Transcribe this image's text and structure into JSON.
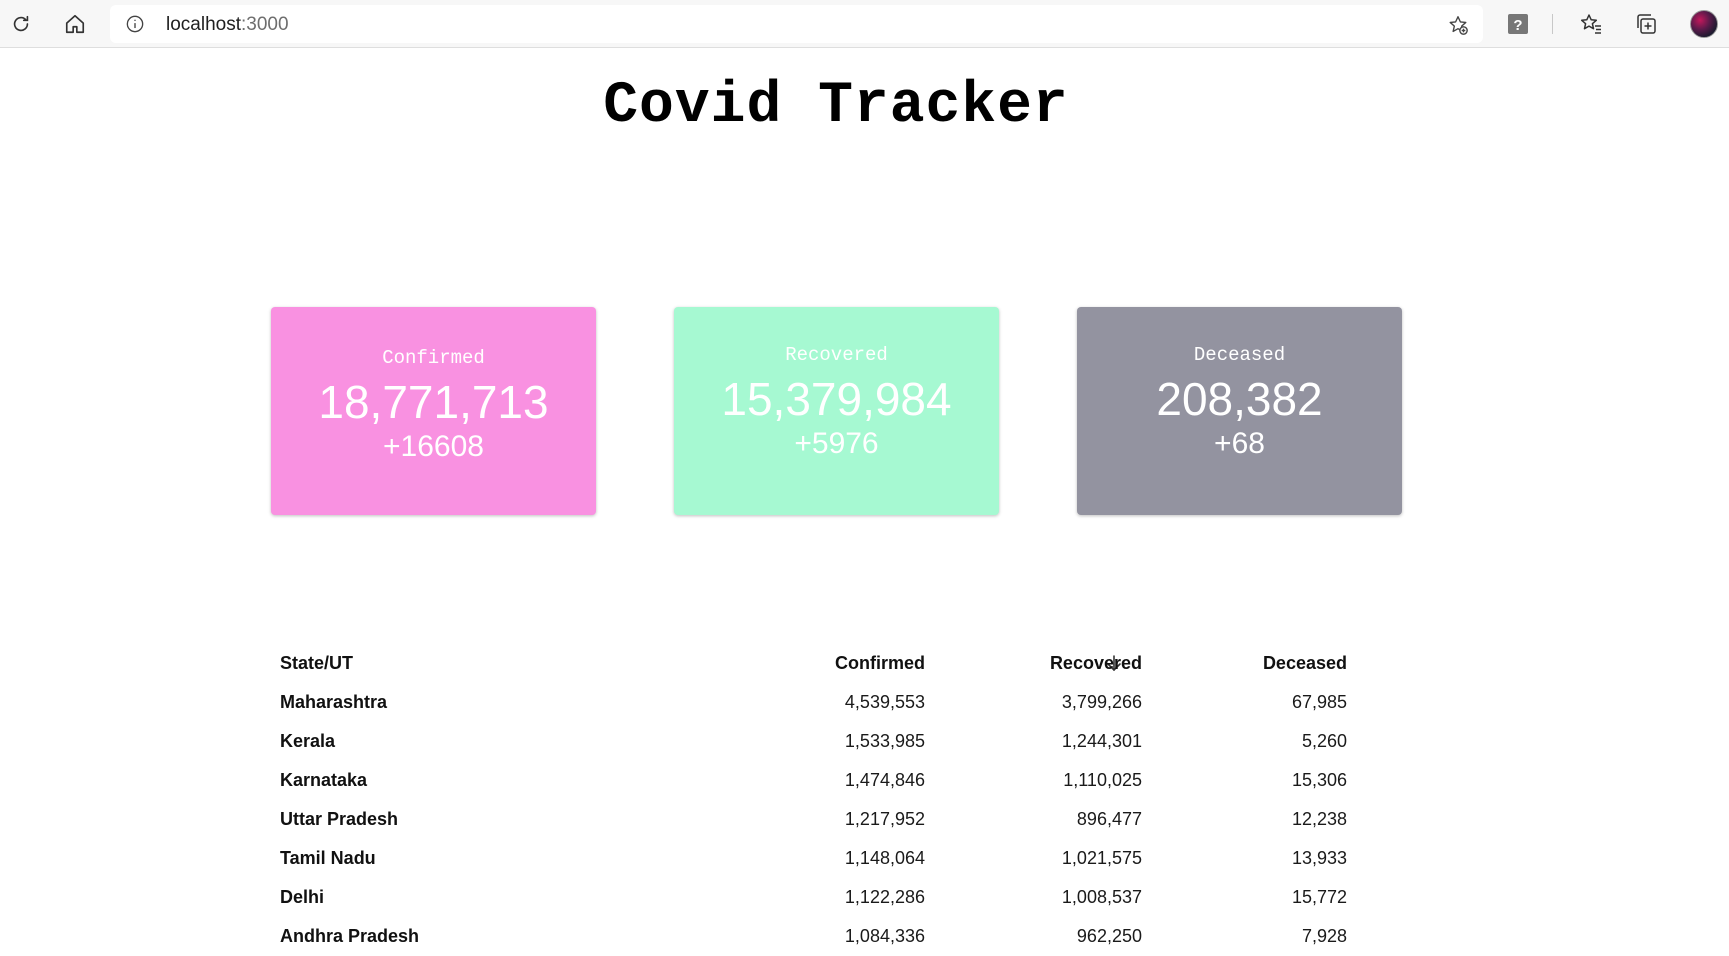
{
  "browser": {
    "url_host": "localhost",
    "url_port": ":3000"
  },
  "page": {
    "title": "Covid Tracker"
  },
  "colors": {
    "confirmed": "#f991e1",
    "recovered": "#a6f9d2",
    "deceased": "#9393a0"
  },
  "cards": {
    "confirmed": {
      "label": "Confirmed",
      "value": "18,771,713",
      "delta": "+16608"
    },
    "recovered": {
      "label": "Recovered",
      "value": "15,379,984",
      "delta": "+5976"
    },
    "deceased": {
      "label": "Deceased",
      "value": "208,382",
      "delta": "+68"
    }
  },
  "table": {
    "headers": {
      "state": "State/UT",
      "confirmed": "Confirmed",
      "recovered": "Recovered",
      "deceased": "Deceased"
    },
    "sort_icon": "arrow-down-icon",
    "rows": [
      {
        "state": "Maharashtra",
        "confirmed": "4,539,553",
        "recovered": "3,799,266",
        "deceased": "67,985"
      },
      {
        "state": "Kerala",
        "confirmed": "1,533,985",
        "recovered": "1,244,301",
        "deceased": "5,260"
      },
      {
        "state": "Karnataka",
        "confirmed": "1,474,846",
        "recovered": "1,110,025",
        "deceased": "15,306"
      },
      {
        "state": "Uttar Pradesh",
        "confirmed": "1,217,952",
        "recovered": "896,477",
        "deceased": "12,238"
      },
      {
        "state": "Tamil Nadu",
        "confirmed": "1,148,064",
        "recovered": "1,021,575",
        "deceased": "13,933"
      },
      {
        "state": "Delhi",
        "confirmed": "1,122,286",
        "recovered": "1,008,537",
        "deceased": "15,772"
      },
      {
        "state": "Andhra Pradesh",
        "confirmed": "1,084,336",
        "recovered": "962,250",
        "deceased": "7,928"
      }
    ]
  }
}
